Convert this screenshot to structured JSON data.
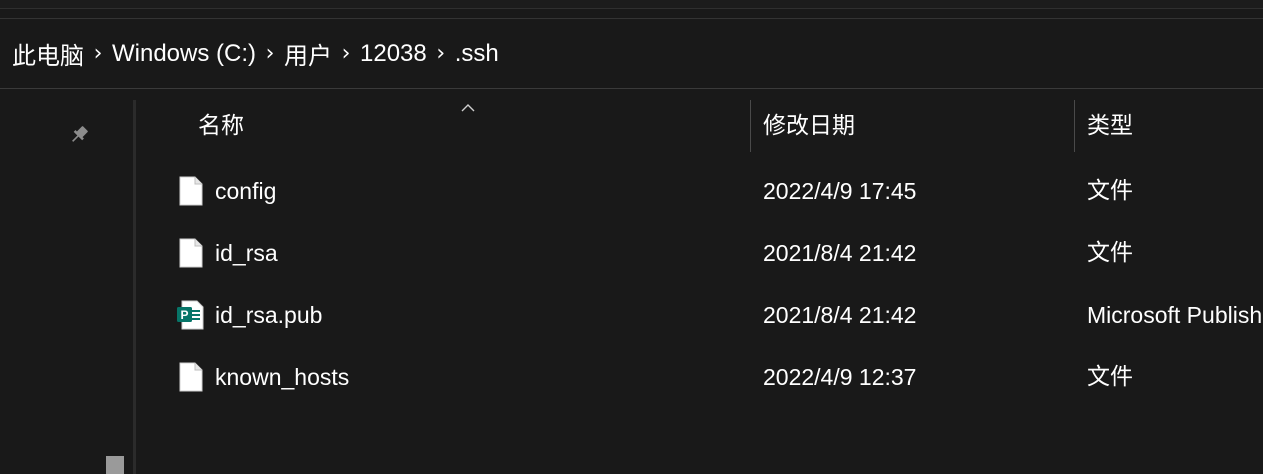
{
  "breadcrumb": {
    "items": [
      "此电脑",
      "Windows (C:)",
      "用户",
      "12038",
      ".ssh"
    ],
    "separator": "›"
  },
  "columns": {
    "name": "名称",
    "date": "修改日期",
    "type": "类型"
  },
  "files": [
    {
      "name": "config",
      "date": "2022/4/9 17:45",
      "type": "文件",
      "icon": "blank-file-icon"
    },
    {
      "name": "id_rsa",
      "date": "2021/8/4 21:42",
      "type": "文件",
      "icon": "blank-file-icon"
    },
    {
      "name": "id_rsa.pub",
      "date": "2021/8/4 21:42",
      "type": "Microsoft Publisher",
      "icon": "publisher-file-icon"
    },
    {
      "name": "known_hosts",
      "date": "2022/4/9 12:37",
      "type": "文件",
      "icon": "blank-file-icon"
    }
  ],
  "colors": {
    "background": "#191919",
    "text": "#ffffff",
    "publisher_teal": "#077568"
  }
}
